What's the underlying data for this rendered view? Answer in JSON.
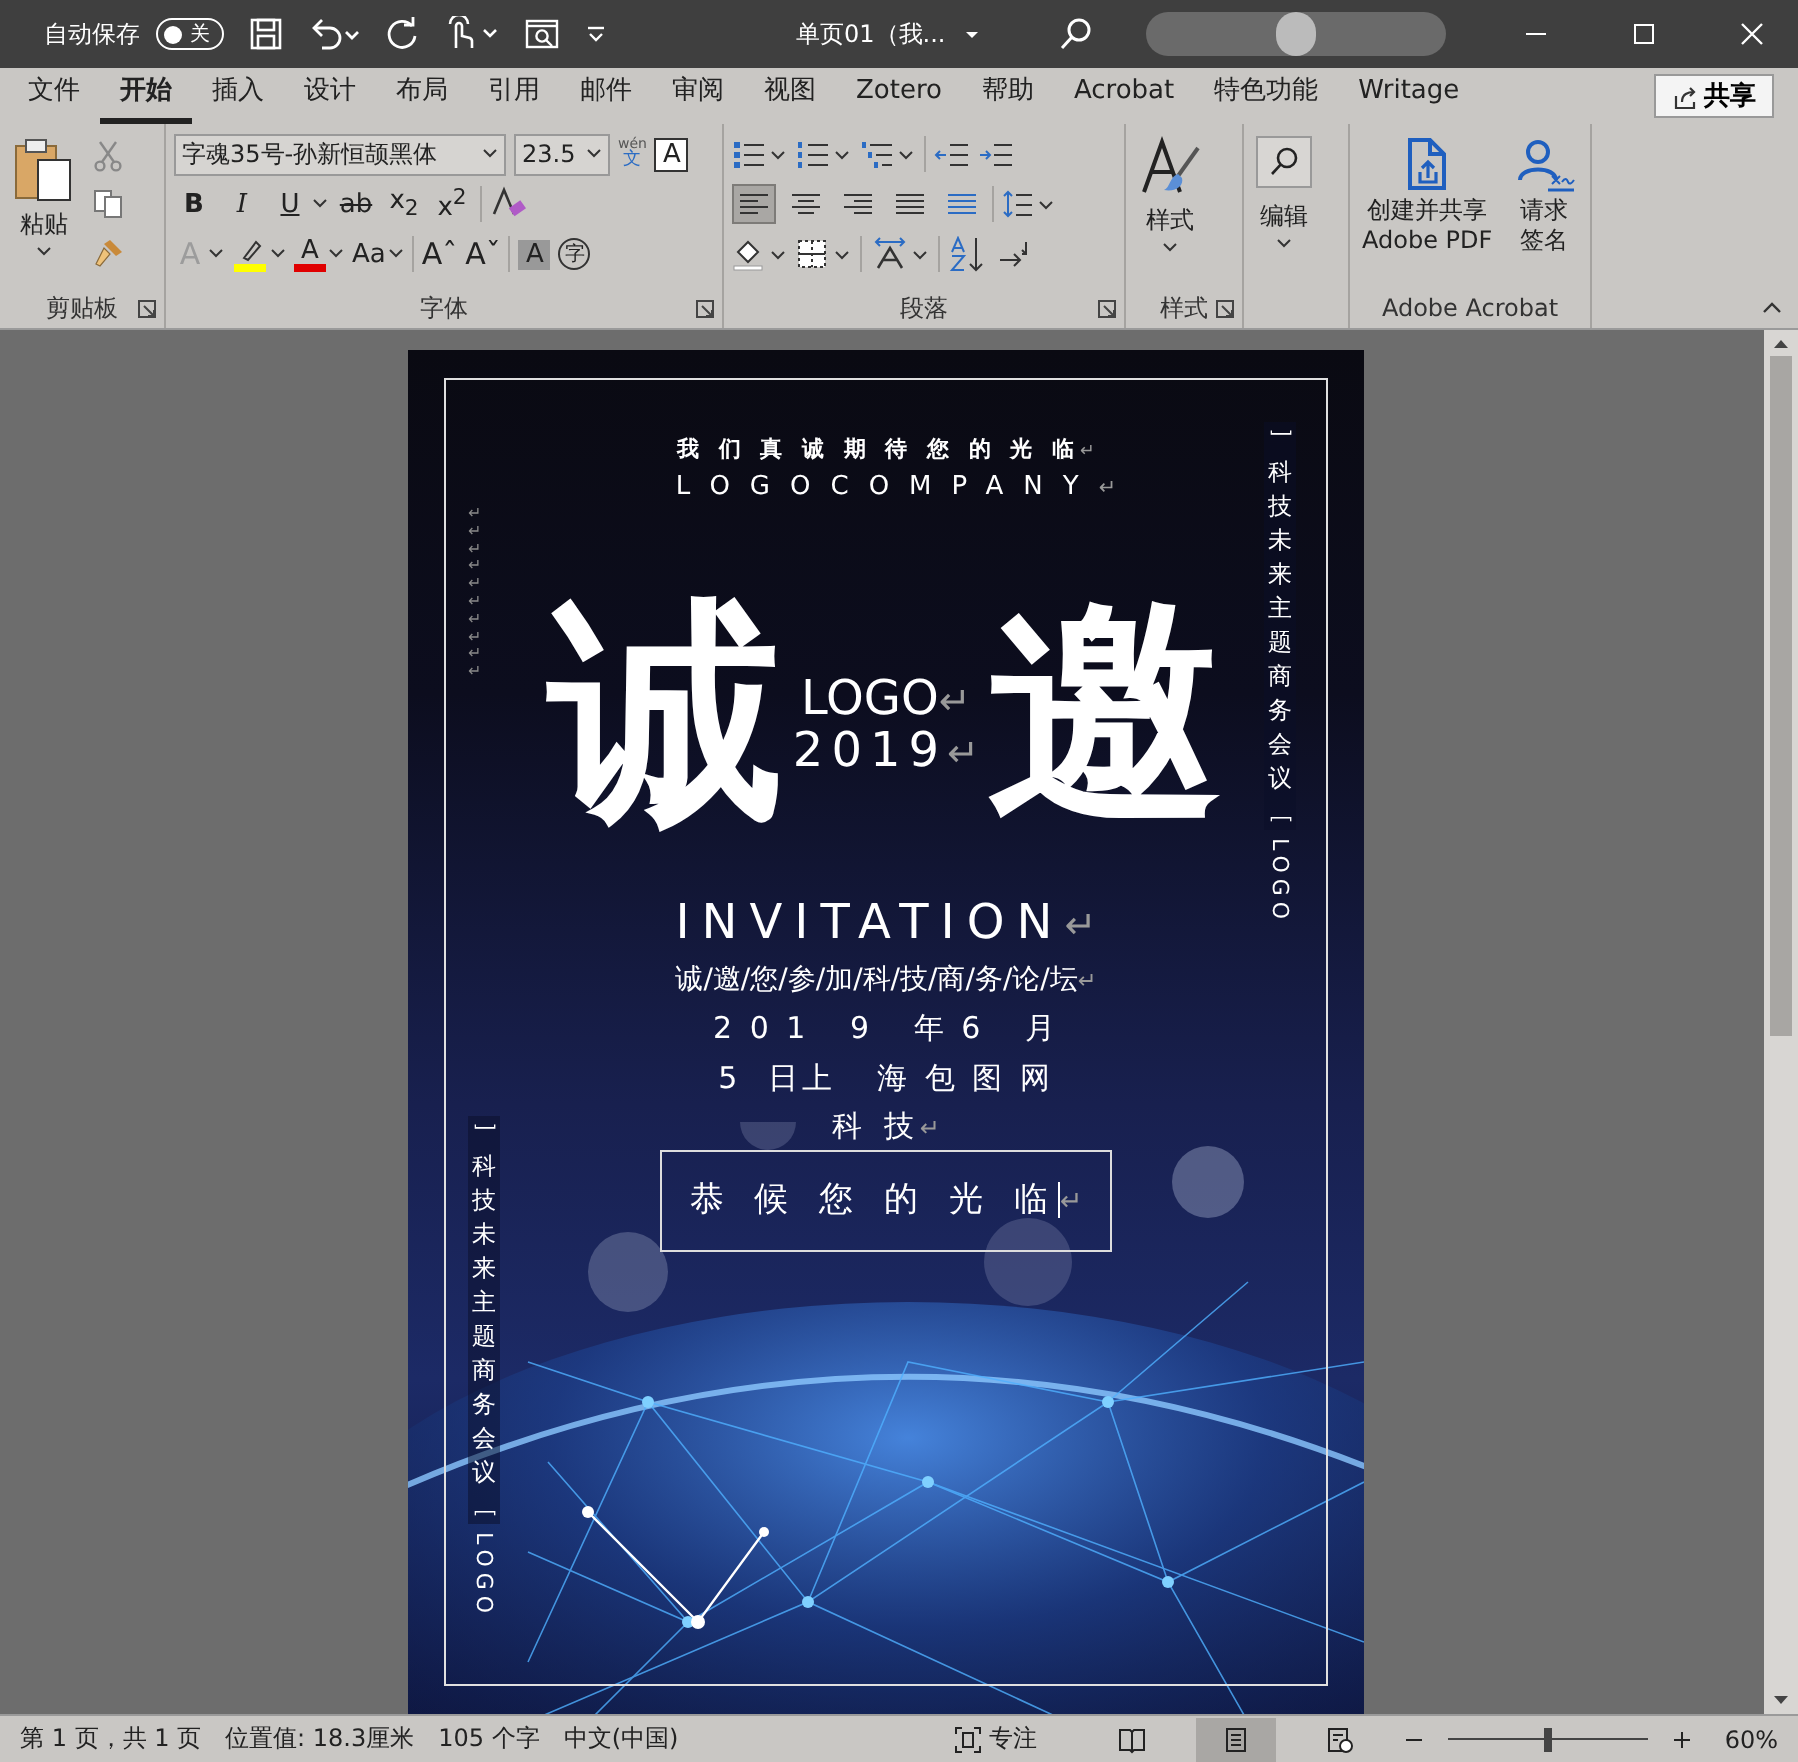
{
  "title_bar": {
    "autosave_label": "自动保存",
    "autosave": {
      "on": false,
      "label": "关"
    },
    "document_title": "单页01（我..."
  },
  "tabs": [
    {
      "label": "文件",
      "selected": false
    },
    {
      "label": "开始",
      "selected": true
    },
    {
      "label": "插入",
      "selected": false
    },
    {
      "label": "设计",
      "selected": false
    },
    {
      "label": "布局",
      "selected": false
    },
    {
      "label": "引用",
      "selected": false
    },
    {
      "label": "邮件",
      "selected": false
    },
    {
      "label": "审阅",
      "selected": false
    },
    {
      "label": "视图",
      "selected": false
    },
    {
      "label": "Zotero",
      "selected": false
    },
    {
      "label": "帮助",
      "selected": false
    },
    {
      "label": "Acrobat",
      "selected": false
    },
    {
      "label": "特色功能",
      "selected": false
    },
    {
      "label": "Writage",
      "selected": false
    }
  ],
  "share_button": "共享",
  "ribbon": {
    "clipboard": {
      "paste": "粘贴",
      "label": "剪贴板"
    },
    "font": {
      "font_name": "字魂35号-孙新恒颉黑体",
      "font_size": "23.5",
      "phonetic": {
        "top": "wén",
        "bottom": "文"
      },
      "char_border": "A",
      "format_buttons": [
        "B",
        "I",
        "U",
        "ab",
        "x$_{2}$",
        "x$^{2}$"
      ],
      "effects": "A",
      "font_color": "A",
      "change_case": "Aa",
      "grow": "Aˆ",
      "shrink": "Aˇ",
      "shading": "A",
      "enclose": "字",
      "label": "字体"
    },
    "paragraph": {
      "label": "段落",
      "alignments": [
        {
          "kind": "left",
          "selected": true
        },
        {
          "kind": "center",
          "selected": false
        },
        {
          "kind": "right",
          "selected": false
        },
        {
          "kind": "justify",
          "selected": false
        },
        {
          "kind": "distributed",
          "selected": false
        }
      ]
    },
    "styles": {
      "button": "样式",
      "label": "样式"
    },
    "editing": {
      "button": "编辑"
    },
    "acrobat": {
      "create": "创建并共享\nAdobe PDF",
      "sign": "请求签名",
      "label": "Adobe Acrobat"
    }
  },
  "document": {
    "tagline": {
      "text": "我 们 真 诚 期 待 您 的 光 临",
      "mark": "↵"
    },
    "company": {
      "text": "LOGOCOMPANY",
      "mark": "↵"
    },
    "title": {
      "first": "诚",
      "second": "邀",
      "logo": "LOGO",
      "year": "2019",
      "mark": "↵"
    },
    "invitation": {
      "text": "INVITATION",
      "mark": "↵"
    },
    "subtitle": {
      "text": "诚/邀/您/参/加/科/技/商/务/论/坛",
      "mark": "↵"
    },
    "date": {
      "text": "2 0 1   9   年 6   月"
    },
    "place": {
      "text": "5  日上   海 包 图 网"
    },
    "tech": {
      "text": "科 技",
      "mark": "↵"
    },
    "greeting": {
      "text": "恭 候 您 的 光 临",
      "mark": "↵"
    },
    "side_labels": [
      {
        "chars": "﹇科技未来主题商务会议﹈",
        "logo": "LOGO"
      },
      {
        "chars": "﹇科技未来主题商务会议﹈",
        "logo": "LOGO"
      }
    ],
    "margin_marks": "↵↵↵↵↵↵↵↵↵↵"
  },
  "status_bar": {
    "page": "第 1 页，共 1 页",
    "position": "位置值: 18.3厘米",
    "words": "105 个字",
    "language": "中文(中国)",
    "focus": "专注",
    "views": [
      {
        "kind": "read",
        "selected": false
      },
      {
        "kind": "print",
        "selected": true
      },
      {
        "kind": "web",
        "selected": false
      }
    ],
    "zoom": {
      "level": 0.5
    },
    "zoom_label": "60%"
  }
}
